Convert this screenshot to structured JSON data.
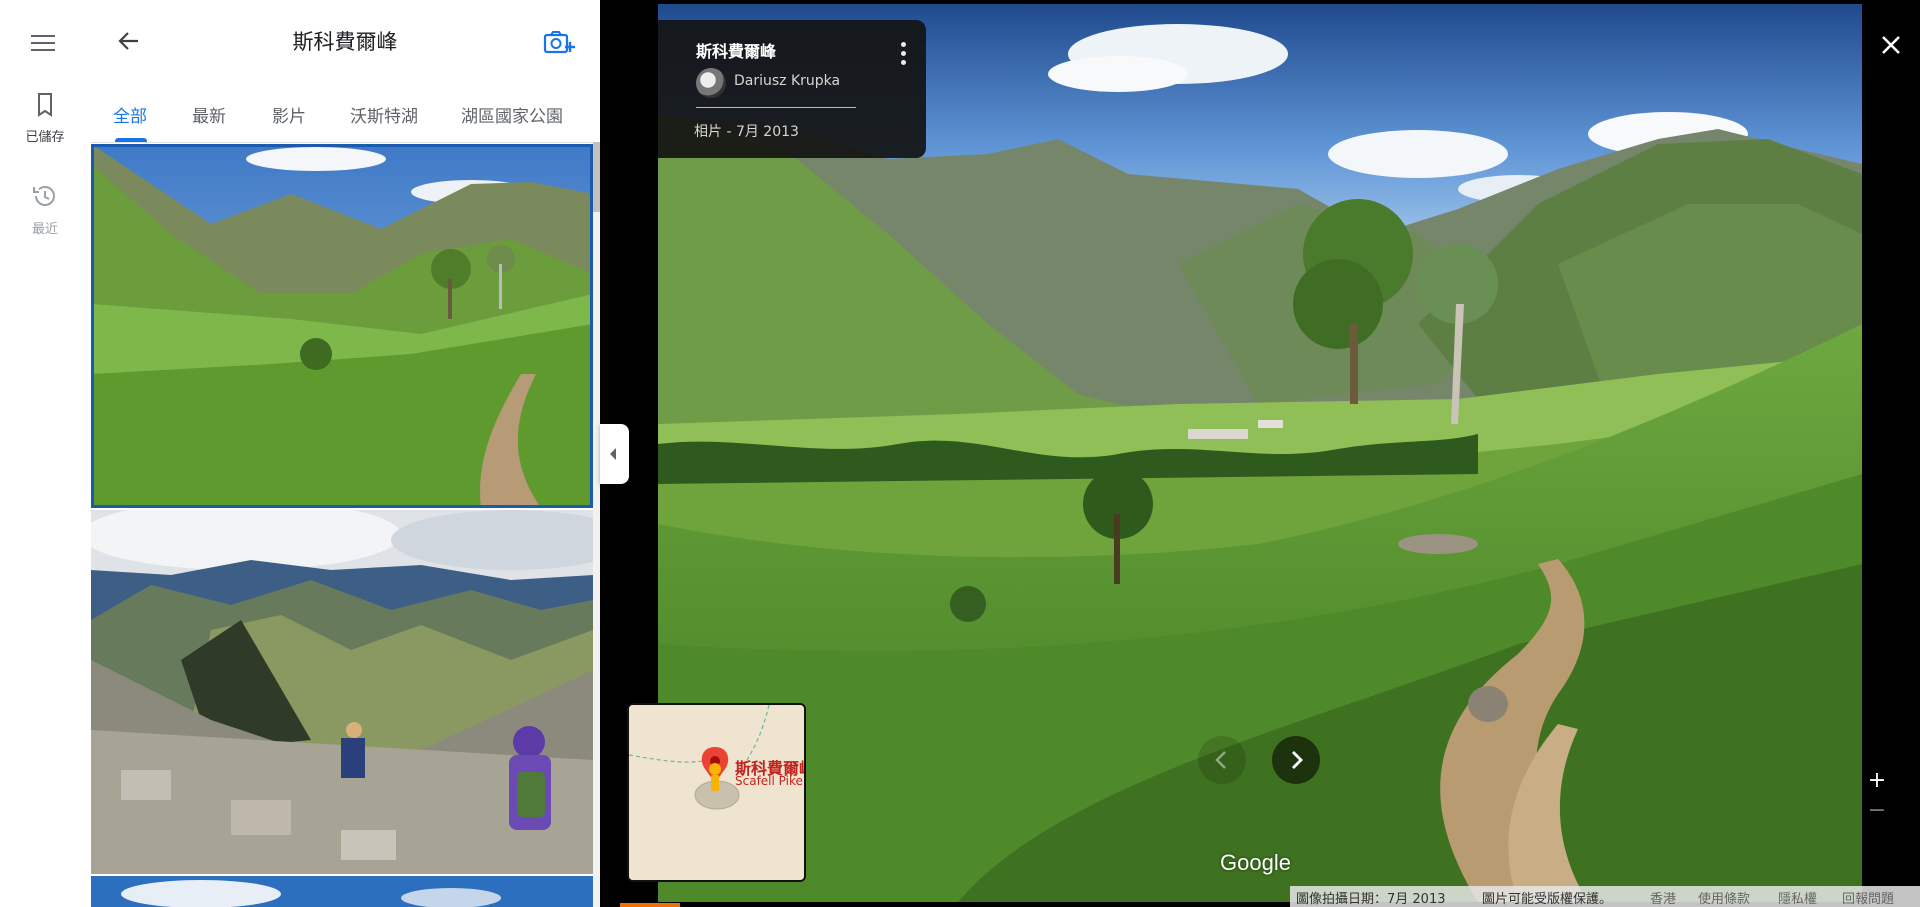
{
  "rail": {
    "saved_label": "已儲存",
    "recent_label": "最近"
  },
  "panel": {
    "title": "斯科費爾峰",
    "tabs": [
      {
        "label": "全部",
        "active": true
      },
      {
        "label": "最新",
        "active": false
      },
      {
        "label": "影片",
        "active": false
      },
      {
        "label": "沃斯特湖",
        "active": false
      },
      {
        "label": "湖區國家公園",
        "active": false
      }
    ]
  },
  "viewer": {
    "place": "斯科費爾峰",
    "author": "Dariusz Krupka",
    "meta": "相片 - 7月 2013"
  },
  "minimap": {
    "name": "斯科費爾峰",
    "sub": "Scafell Pike"
  },
  "branding": {
    "logo": "Google"
  },
  "footer": {
    "capture_date": "圖像拍攝日期：7月 2013",
    "copyright": "圖片可能受版權保護。",
    "region": "香港",
    "terms": "使用條款",
    "privacy": "隱私權",
    "report": "回報問題"
  },
  "zoom": {
    "plus": "+",
    "minus": "−"
  },
  "colors": {
    "accent": "#1a73e8",
    "selected_outline": "#1a5bb0",
    "map_pin": "#ea4335",
    "map_label": "#c5221f"
  },
  "icons": [
    "menu-icon",
    "bookmark-icon",
    "history-icon",
    "back-arrow-icon",
    "add-photo-icon",
    "collapse-left-icon",
    "more-vert-icon",
    "close-icon",
    "chevron-left-icon",
    "chevron-right-icon",
    "location-pin-icon",
    "pegman-icon"
  ]
}
